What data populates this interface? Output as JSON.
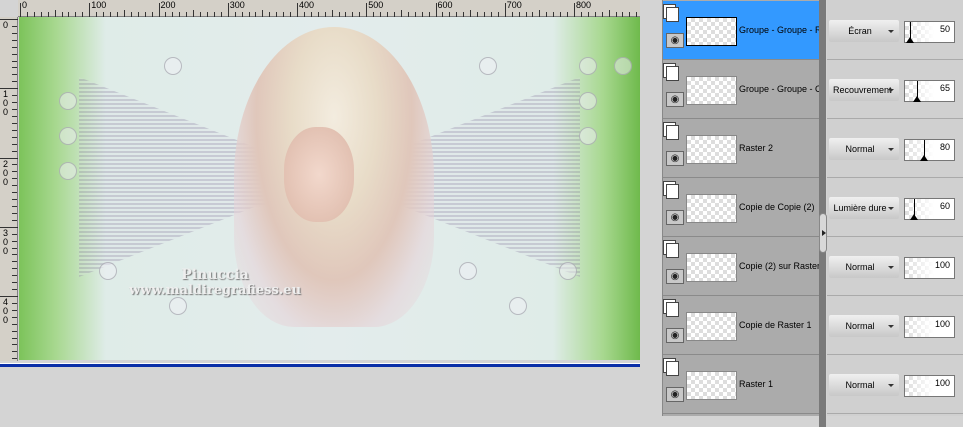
{
  "ruler": {
    "h_labels": [
      "0",
      "100",
      "200",
      "300",
      "400",
      "500",
      "600",
      "700",
      "800"
    ],
    "v_labels": [
      "0",
      "100",
      "200",
      "300",
      "400"
    ]
  },
  "canvas": {
    "watermark_line1": "Pinuccia",
    "watermark_line2": "www.maldiregrafiess.eu"
  },
  "layers": [
    {
      "name": "Groupe - Groupe - Raster",
      "blend": "Écran",
      "opacity": 50,
      "selected": true
    },
    {
      "name": "Groupe - Groupe - Copie",
      "blend": "Recouvrement",
      "opacity": 65,
      "selected": false
    },
    {
      "name": "Raster 2",
      "blend": "Normal",
      "opacity": 80,
      "selected": false
    },
    {
      "name": "Copie de Copie (2)",
      "blend": "Lumière dure",
      "opacity": 60,
      "selected": false
    },
    {
      "name": "Copie (2) sur Raster",
      "blend": "Normal",
      "opacity": 100,
      "selected": false
    },
    {
      "name": "Copie de Raster 1",
      "blend": "Normal",
      "opacity": 100,
      "selected": false
    },
    {
      "name": "Raster 1",
      "blend": "Normal",
      "opacity": 100,
      "selected": false
    }
  ],
  "colors": {
    "selection": "#3399ff",
    "canvas_border": "#0b2fa8"
  }
}
